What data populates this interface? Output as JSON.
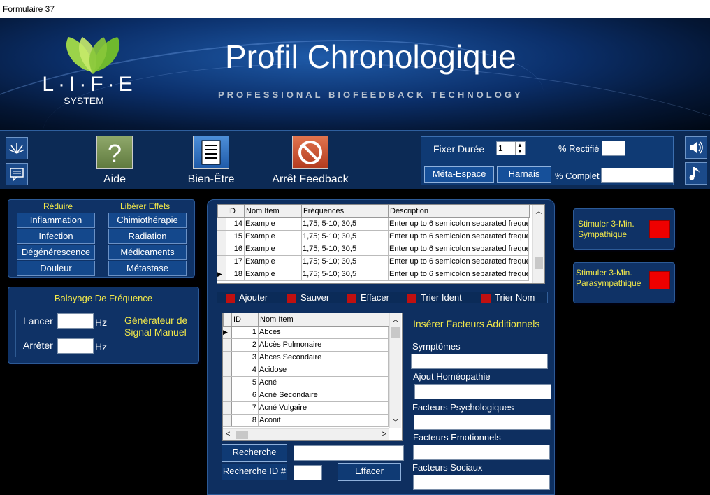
{
  "window": {
    "title": "Formulaire 37"
  },
  "header": {
    "title": "Profil Chronologique",
    "subtitle": "PROFESSIONAL BIOFEEDBACK TECHNOLOGY",
    "logo": {
      "text": "L·I·F·E",
      "subtext": "SYSTEM"
    }
  },
  "toolbar": {
    "side_icons": [
      "spark-icon",
      "chat-icon"
    ],
    "buttons": [
      {
        "label": "Aide",
        "icon": "question-icon"
      },
      {
        "label": "Bien-Être",
        "icon": "document-icon"
      },
      {
        "label": "Arrêt Feedback",
        "icon": "stop-icon"
      }
    ],
    "settings": {
      "duration_label": "Fixer Durée",
      "duration_value": "1",
      "rectified_label": "% Rectifié",
      "rectified_value": "",
      "complete_label": "% Complet",
      "complete_value": "",
      "meta_button": "Méta-Espace",
      "harness_button": "Harnais"
    },
    "right_icons": [
      "speaker-icon",
      "music-note-icon"
    ]
  },
  "left_panel": {
    "reduce_title": "Réduire",
    "release_title": "Libérer Effets",
    "reduce_items": [
      "Inflammation",
      "Infection",
      "Dégénérescence",
      "Douleur"
    ],
    "release_items": [
      "Chimiothérapie",
      "Radiation",
      "Médicaments",
      "Métastase"
    ]
  },
  "sweep_panel": {
    "title": "Balayage De Fréquence",
    "start_label": "Lancer",
    "start_value": "",
    "stop_label": "Arrêter",
    "stop_value": "",
    "unit": "Hz",
    "generator_label": "Générateur de Signal Manuel"
  },
  "top_grid": {
    "columns": [
      "ID",
      "Nom Item",
      "Fréquences",
      "Description"
    ],
    "rows": [
      {
        "id": "14",
        "name": "Example",
        "freq": "1,75; 5-10; 30,5",
        "desc": "Enter up to 6 semicolon separated frequer",
        "current": false
      },
      {
        "id": "15",
        "name": "Example",
        "freq": "1,75; 5-10; 30,5",
        "desc": "Enter up to 6 semicolon separated frequer",
        "current": false
      },
      {
        "id": "16",
        "name": "Example",
        "freq": "1,75; 5-10; 30,5",
        "desc": "Enter up to 6 semicolon separated frequer",
        "current": false
      },
      {
        "id": "17",
        "name": "Example",
        "freq": "1,75; 5-10; 30,5",
        "desc": "Enter up to 6 semicolon separated frequer",
        "current": false
      },
      {
        "id": "18",
        "name": "Example",
        "freq": "1,75; 5-10; 30,5",
        "desc": "Enter up to 6 semicolon separated frequer",
        "current": true
      }
    ]
  },
  "actions": [
    "Ajouter",
    "Sauver",
    "Effacer",
    "Trier Ident",
    "Trier Nom"
  ],
  "bottom_grid": {
    "columns": [
      "ID",
      "Nom Item"
    ],
    "rows": [
      {
        "id": "1",
        "name": "Abcès",
        "current": true
      },
      {
        "id": "2",
        "name": "Abcès Pulmonaire",
        "current": false
      },
      {
        "id": "3",
        "name": "Abcès Secondaire",
        "current": false
      },
      {
        "id": "4",
        "name": "Acidose",
        "current": false
      },
      {
        "id": "5",
        "name": "Acné",
        "current": false
      },
      {
        "id": "6",
        "name": "Acné Secondaire",
        "current": false
      },
      {
        "id": "7",
        "name": "Acné Vulgaire",
        "current": false
      },
      {
        "id": "8",
        "name": "Aconit",
        "current": false
      }
    ]
  },
  "search": {
    "search_button": "Recherche",
    "search_value": "",
    "search_id_label": "Recherche ID #",
    "search_id_value": "",
    "clear_button": "Effacer"
  },
  "additional": {
    "title": "Insérer Facteurs Additionnels",
    "fields": [
      {
        "label": "Symptômes",
        "value": ""
      },
      {
        "label": "Ajout Homéopathie",
        "value": ""
      },
      {
        "label": "Facteurs Psychologiques",
        "value": ""
      },
      {
        "label": "Facteurs Emotionnels",
        "value": ""
      },
      {
        "label": "Facteurs Sociaux",
        "value": ""
      }
    ]
  },
  "stimulate": [
    {
      "label": "Stimuler  3-Min. Sympathique"
    },
    {
      "label": "Stimuler 3-Min. Parasympathique"
    }
  ]
}
